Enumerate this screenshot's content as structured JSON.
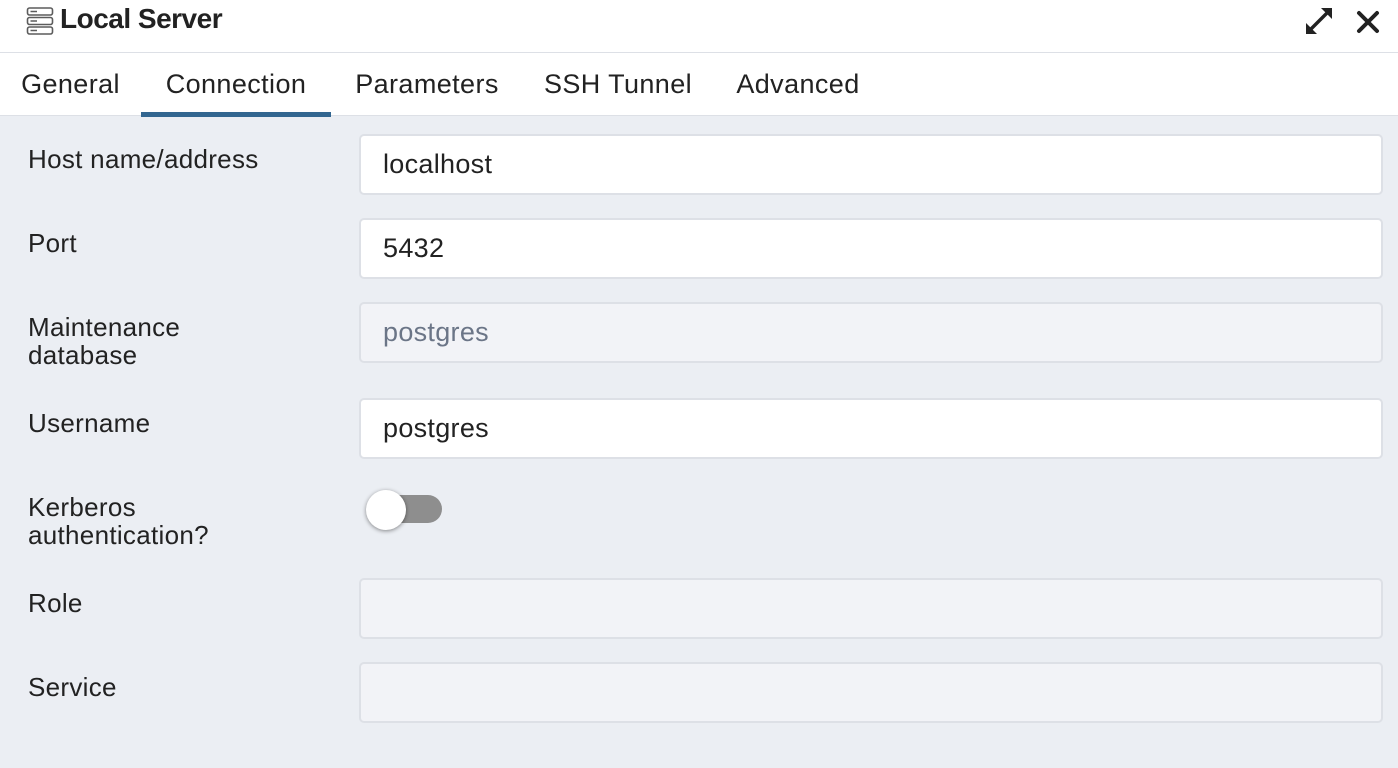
{
  "window": {
    "title": "Local Server",
    "title_icon": "server-icon",
    "maximize_icon": "expand-arrows-icon",
    "close_icon": "close-icon"
  },
  "tabs": [
    {
      "label": "General",
      "active": false
    },
    {
      "label": "Connection",
      "active": true
    },
    {
      "label": "Parameters",
      "active": false
    },
    {
      "label": "SSH Tunnel",
      "active": false
    },
    {
      "label": "Advanced",
      "active": false
    }
  ],
  "form": {
    "host": {
      "label": "Host name/address",
      "value": "localhost"
    },
    "port": {
      "label": "Port",
      "value": "5432"
    },
    "maintenance_db": {
      "label_line1": "Maintenance",
      "label_line2": "database",
      "value": "postgres",
      "disabled": true
    },
    "username": {
      "label": "Username",
      "value": "postgres"
    },
    "kerberos": {
      "label_line1": "Kerberos",
      "label_line2": "authentication?",
      "enabled": false
    },
    "role": {
      "label": "Role",
      "value": "",
      "disabled": true
    },
    "service": {
      "label": "Service",
      "value": "",
      "disabled": true
    }
  },
  "colors": {
    "accent": "#326690",
    "panel_background": "#ebeef3",
    "toggle_off": "#8e8e8e"
  }
}
